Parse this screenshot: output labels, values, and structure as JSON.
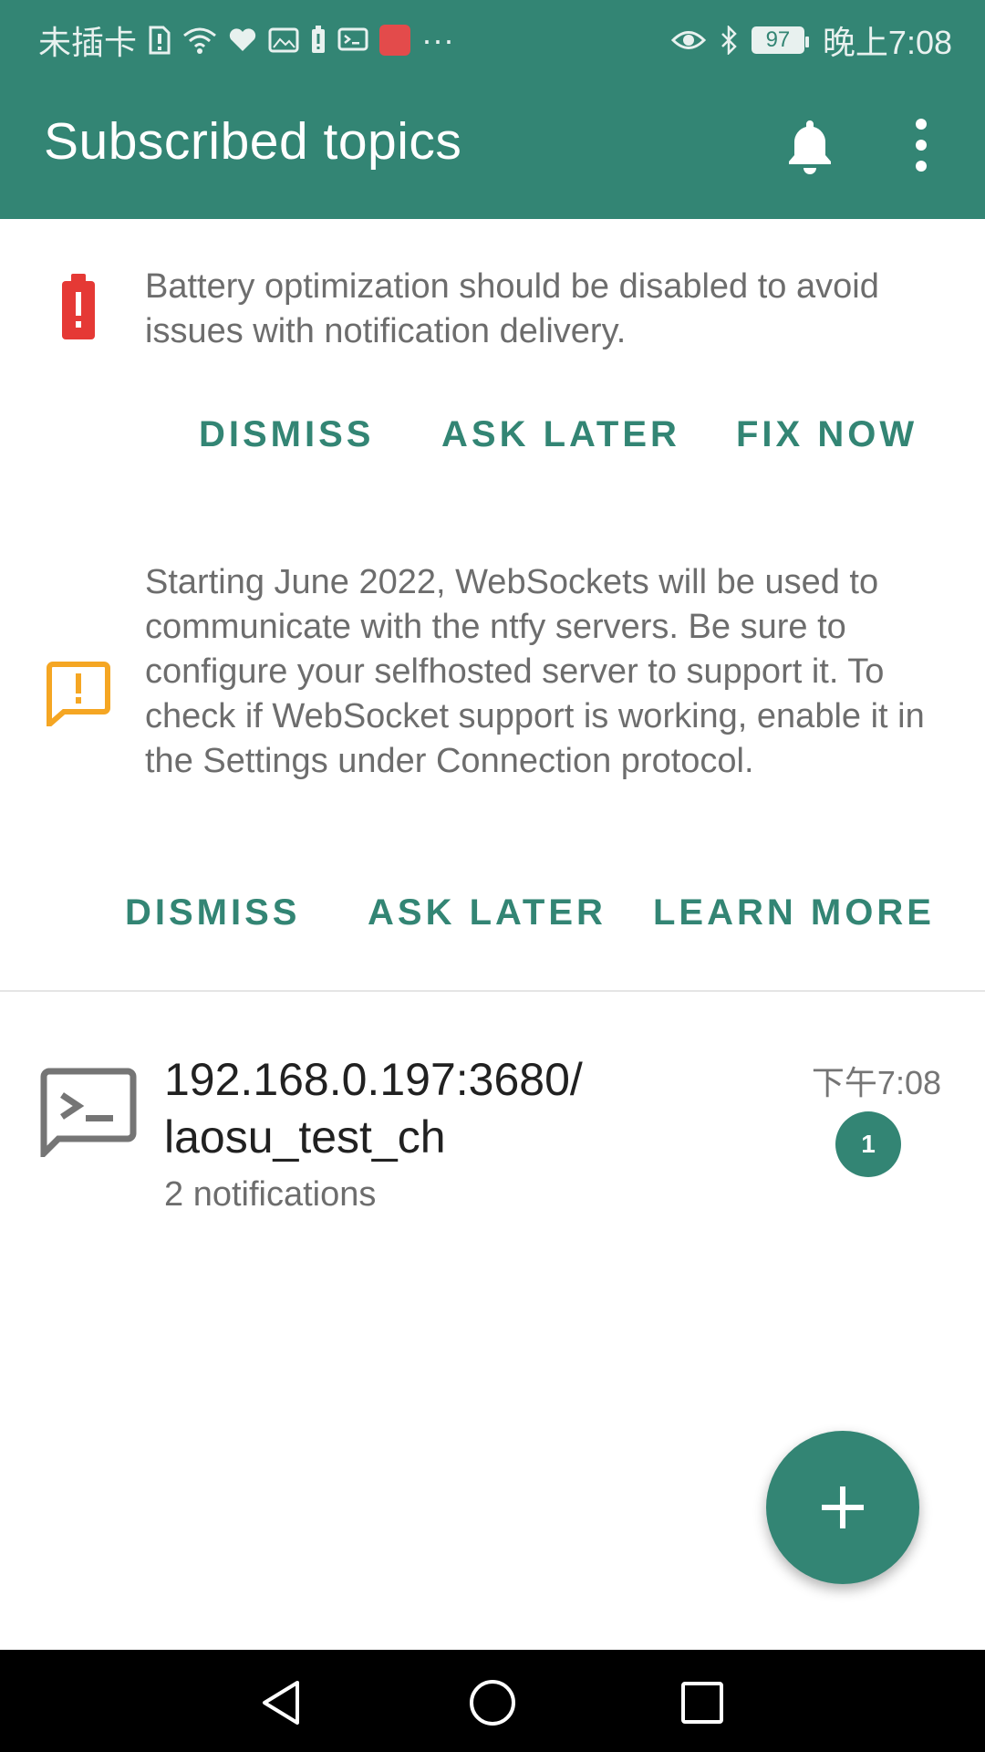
{
  "status_bar": {
    "carrier": "未插卡",
    "battery_level": "97",
    "time": "晚上7:08",
    "more_indicator": "···",
    "icons_left": [
      "sim-alert-icon",
      "wifi-icon",
      "heart-icon",
      "image-icon",
      "battery-alert-icon",
      "terminal-icon",
      "huawei-app-icon"
    ],
    "icons_right": [
      "eye-icon",
      "bluetooth-icon"
    ]
  },
  "app_bar": {
    "title": "Subscribed topics",
    "actions": [
      "bell-icon",
      "more-vert-icon"
    ]
  },
  "battery_card": {
    "message": "Battery optimization should be disabled to avoid issues with notification delivery.",
    "icon": "battery-alert-icon",
    "icon_color": "#e53935",
    "actions": {
      "dismiss": "DISMISS",
      "ask_later": "ASK LATER",
      "fix_now": "FIX NOW"
    }
  },
  "websocket_card": {
    "message": "Starting June 2022, WebSockets will be used to communicate with the ntfy servers. Be sure to configure your selfhosted server to support it. To check if WebSocket support is working, enable it in the Settings under Connection protocol.",
    "icon": "announcement-icon",
    "icon_color": "#f5a623",
    "actions": {
      "dismiss": "DISMISS",
      "ask_later": "ASK LATER",
      "learn_more": "LEARN MORE"
    }
  },
  "topics": [
    {
      "title": "192.168.0.197:3680/\nlaosu_test_ch",
      "subtitle": "2 notifications",
      "time": "下午7:08",
      "badge": "1",
      "icon": "terminal-icon"
    }
  ],
  "fab": {
    "icon": "plus-icon"
  },
  "nav_bar": {
    "buttons": [
      "back-icon",
      "home-icon",
      "recents-icon"
    ]
  },
  "colors": {
    "primary": "#338574",
    "text_secondary": "#6d6d6d",
    "text_primary": "#212121"
  }
}
